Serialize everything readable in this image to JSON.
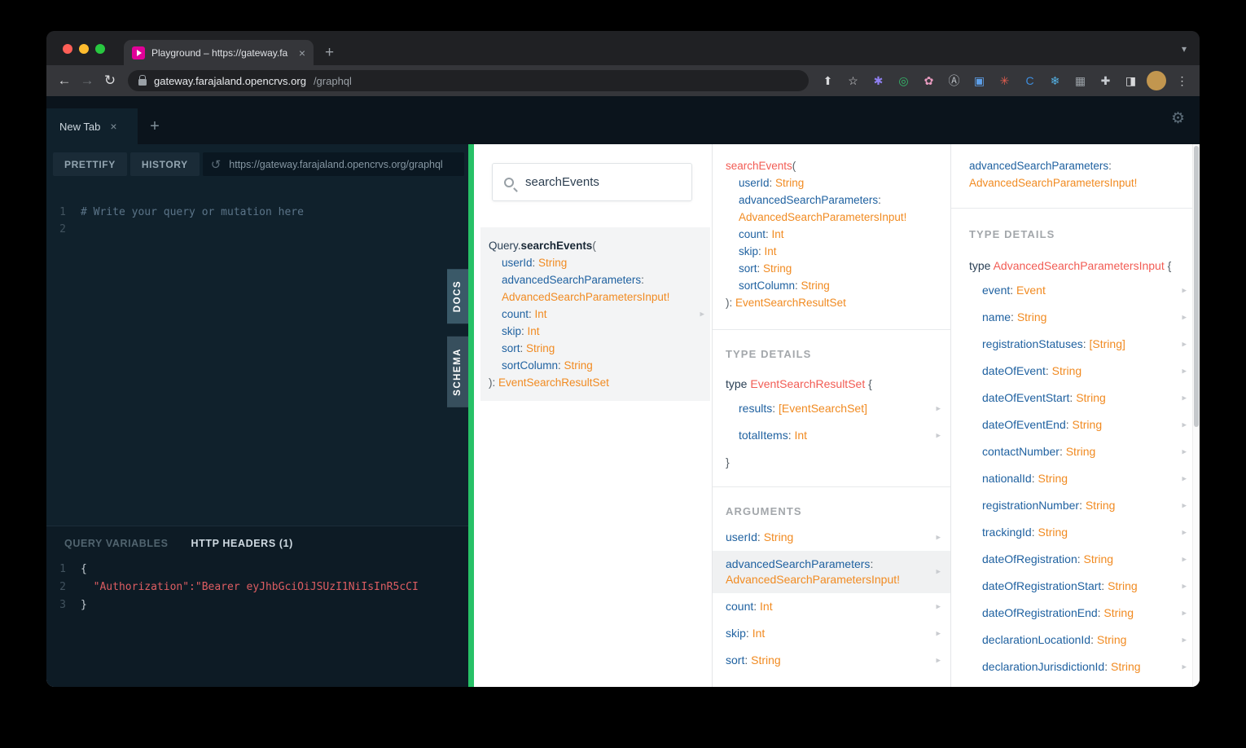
{
  "colors": {
    "accent_green": "#27c167",
    "docs_field_blue": "#1f61a0",
    "docs_type_orange": "#f18b22",
    "docs_name_red": "#f25c54",
    "favicon_pink": "#e10098"
  },
  "browser": {
    "tab_title": "Playground – https://gateway.fa",
    "url_host": "gateway.farajaland.opencrvs.org",
    "url_path": "/graphql",
    "icons": [
      {
        "name": "share-icon",
        "glyph": "⬆",
        "color": "#d8d9db"
      },
      {
        "name": "bookmark-star-icon",
        "glyph": "☆",
        "color": "#d8d9db"
      },
      {
        "name": "extension-icon-1",
        "glyph": "✱",
        "color": "#8f7ff0"
      },
      {
        "name": "extension-icon-2",
        "glyph": "◎",
        "color": "#35b96a"
      },
      {
        "name": "extension-icon-3",
        "glyph": "✿",
        "color": "#e89bbf"
      },
      {
        "name": "extension-icon-4",
        "glyph": "Ⓐ",
        "color": "#b9bec3"
      },
      {
        "name": "extension-icon-5",
        "glyph": "▣",
        "color": "#5e9fe8"
      },
      {
        "name": "extension-icon-6",
        "glyph": "✳",
        "color": "#e25d4f"
      },
      {
        "name": "extension-icon-7",
        "glyph": "C",
        "color": "#3e8ddd"
      },
      {
        "name": "extension-icon-8",
        "glyph": "❄",
        "color": "#54b1e4"
      },
      {
        "name": "extension-icon-9",
        "glyph": "▦",
        "color": "#9aa0a6"
      },
      {
        "name": "extension-icon-10",
        "glyph": "✚",
        "color": "#c7cbd0"
      },
      {
        "name": "split-view-icon",
        "glyph": "◨",
        "color": "#d8d9db"
      },
      {
        "name": "profile-avatar",
        "glyph": "",
        "color": "#ffffff",
        "bg": "#c2964f"
      },
      {
        "name": "menu-kebab-icon",
        "glyph": "⋮",
        "color": "#d8d9db"
      }
    ]
  },
  "playground": {
    "tab_label": "New Tab",
    "toolbar": {
      "prettify": "PRETTIFY",
      "history": "HISTORY",
      "endpoint": "https://gateway.farajaland.opencrvs.org/graphql"
    },
    "editor_lines": [
      {
        "num": "1",
        "text": "# Write your query or mutation here",
        "cls": "comment"
      },
      {
        "num": "2",
        "text": "",
        "cls": ""
      }
    ],
    "vars_tabs": {
      "variables": "QUERY VARIABLES",
      "headers": "HTTP HEADERS (1)"
    },
    "headers_lines": [
      {
        "num": "1",
        "text": "{",
        "cls": "brace"
      },
      {
        "num": "2",
        "text": "  \"Authorization\":\"Bearer eyJhbGciOiJSUzI1NiIsInR5cCI",
        "cls": "string"
      },
      {
        "num": "3",
        "text": "}",
        "cls": "brace"
      }
    ],
    "side_tabs": {
      "docs": "DOCS",
      "schema": "SCHEMA"
    }
  },
  "docs": {
    "search_value": "searchEvents",
    "column1": {
      "item": {
        "prefix": "Query.",
        "name": "searchEvents",
        "args": [
          {
            "name": "userId",
            "type": "String"
          },
          {
            "name": "advancedSearchParameters",
            "type": "AdvancedSearchParametersInput!",
            "wrap": true
          },
          {
            "name": "count",
            "type": "Int"
          },
          {
            "name": "skip",
            "type": "Int"
          },
          {
            "name": "sort",
            "type": "String"
          },
          {
            "name": "sortColumn",
            "type": "String"
          }
        ],
        "return_type": "EventSearchResultSet"
      }
    },
    "column2": {
      "signature": {
        "name": "searchEvents",
        "args": [
          {
            "name": "userId",
            "type": "String"
          },
          {
            "name": "advancedSearchParameters",
            "type": "AdvancedSearchParametersInput!",
            "wrap": true
          },
          {
            "name": "count",
            "type": "Int"
          },
          {
            "name": "skip",
            "type": "Int"
          },
          {
            "name": "sort",
            "type": "String"
          },
          {
            "name": "sortColumn",
            "type": "String"
          }
        ],
        "return_type": "EventSearchResultSet"
      },
      "type_details_label": "TYPE DETAILS",
      "type_decl": {
        "keyword": "type",
        "name": "EventSearchResultSet",
        "close": true,
        "fields": [
          {
            "name": "results",
            "type": "[EventSearchSet]"
          },
          {
            "name": "totalItems",
            "type": "Int"
          }
        ]
      },
      "arguments_label": "ARGUMENTS",
      "arguments": [
        {
          "name": "userId",
          "type": "String"
        },
        {
          "name": "advancedSearchParameters",
          "type": "AdvancedSearchParametersInput!",
          "wrap": true,
          "selected": true
        },
        {
          "name": "count",
          "type": "Int"
        },
        {
          "name": "skip",
          "type": "Int"
        },
        {
          "name": "sort",
          "type": "String"
        }
      ]
    },
    "column3": {
      "header": {
        "name": "advancedSearchParameters",
        "type": "AdvancedSearchParametersInput!"
      },
      "type_details_label": "TYPE DETAILS",
      "type_decl": {
        "keyword": "type",
        "name": "AdvancedSearchParametersInput",
        "close": false,
        "fields": [
          {
            "name": "event",
            "type": "Event"
          },
          {
            "name": "name",
            "type": "String"
          },
          {
            "name": "registrationStatuses",
            "type": "[String]"
          },
          {
            "name": "dateOfEvent",
            "type": "String"
          },
          {
            "name": "dateOfEventStart",
            "type": "String"
          },
          {
            "name": "dateOfEventEnd",
            "type": "String"
          },
          {
            "name": "contactNumber",
            "type": "String"
          },
          {
            "name": "nationalId",
            "type": "String"
          },
          {
            "name": "registrationNumber",
            "type": "String"
          },
          {
            "name": "trackingId",
            "type": "String"
          },
          {
            "name": "dateOfRegistration",
            "type": "String"
          },
          {
            "name": "dateOfRegistrationStart",
            "type": "String"
          },
          {
            "name": "dateOfRegistrationEnd",
            "type": "String"
          },
          {
            "name": "declarationLocationId",
            "type": "String"
          },
          {
            "name": "declarationJurisdictionId",
            "type": "String"
          }
        ]
      }
    }
  }
}
